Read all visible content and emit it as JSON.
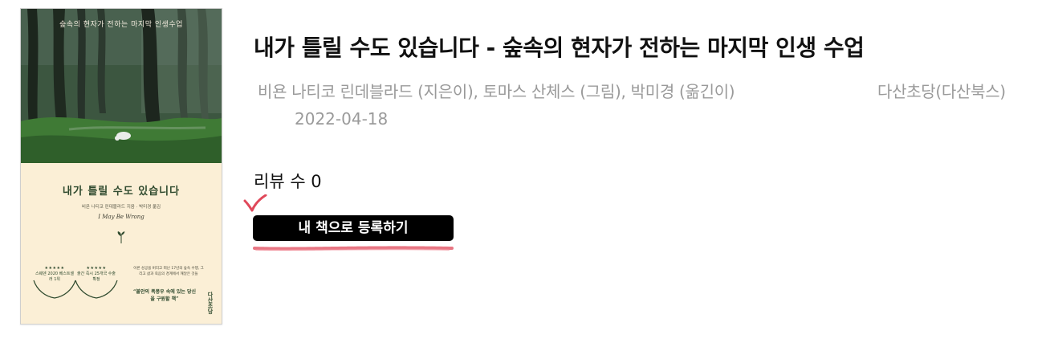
{
  "cover": {
    "top_text": "숲속의 현자가 전하는 마지막 인생수업",
    "title": "내가 틀릴 수도 있습니다",
    "credits": "비욘 나티코 린데블라드 지음 · 박미경 옮김",
    "subtitle": "I May Be Wrong",
    "badge1_stars": "★★★★★",
    "badge1_text": "스웨덴 2020 베스트셀러 1위",
    "badge2_stars": "★★★★★",
    "badge2_text": "출간 즉시 25개국 수출 확정",
    "blurb": "이른 성공을 버리고 떠난 17년의 숲속 수행, 그리고 삶과 죽음의 경계에서 깨달은 것들",
    "quote": "“불안의 폭풍우 속에 있는 당신을 구원할 책”",
    "publisher_mark": "다산초당"
  },
  "book": {
    "title": "내가 틀릴 수도 있습니다 - 숲속의 현자가 전하는 마지막 인생 수업",
    "authors": "비욘 나티코 린데블라드 (지은이), 토마스 산체스 (그림), 박미경 (옮긴이)",
    "publisher": "다산초당(다산북스)",
    "date": "2022-04-18",
    "reviews": "리뷰 수 0"
  },
  "actions": {
    "add_to_my_books": "내 책으로 등록하기"
  },
  "colors": {
    "button_bg": "#000000",
    "button_text": "#ffffff",
    "meta_text": "#9a9a9a",
    "accent_mark": "#e0485a",
    "cover_green": "#2f4a2e",
    "cover_cream": "#fbefd6"
  },
  "icons": {
    "check": "check-icon"
  }
}
